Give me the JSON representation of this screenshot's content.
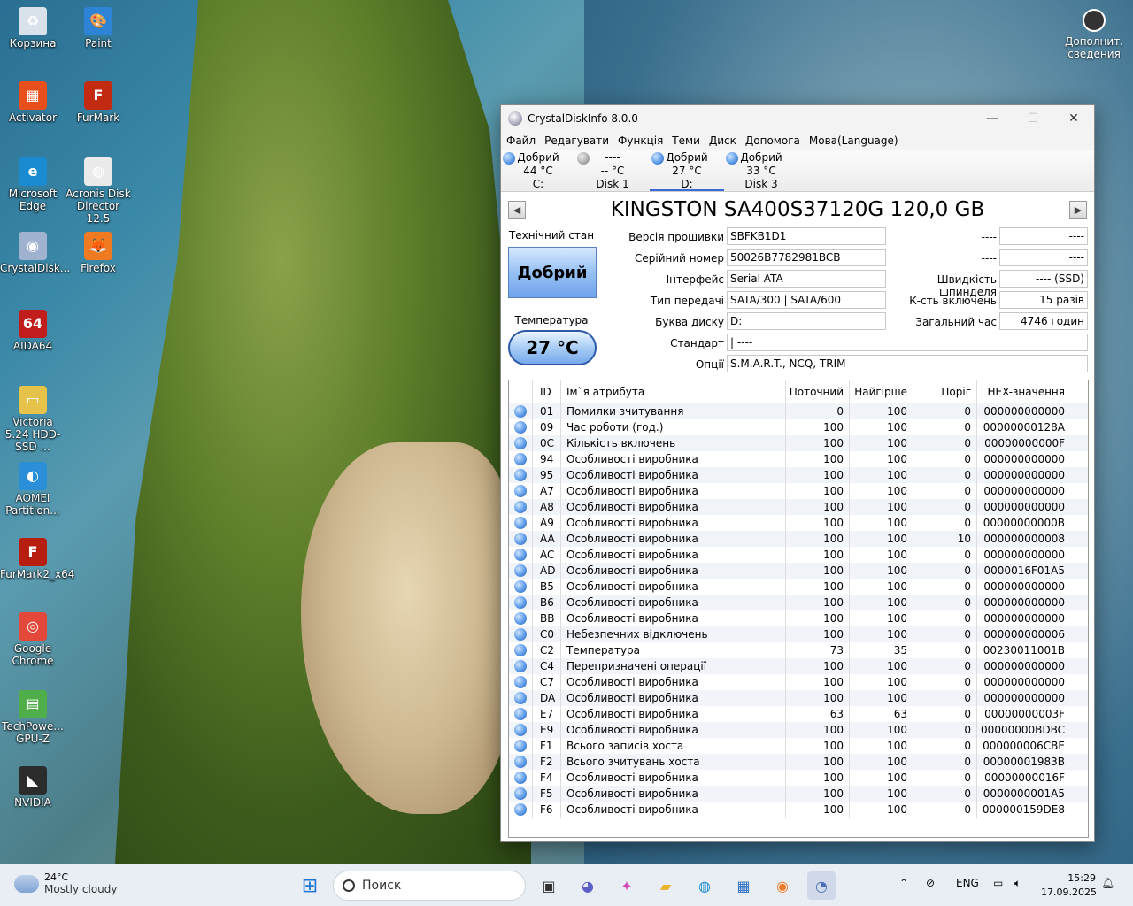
{
  "desktop": {
    "icons": [
      {
        "label": "Корзина",
        "glyph": "♻",
        "color": "#d9e2ea"
      },
      {
        "label": "Paint",
        "glyph": "🎨",
        "color": "#2d83d6"
      },
      {
        "label": "Activator",
        "glyph": "▦",
        "color": "#e84f1a"
      },
      {
        "label": "FurMark",
        "glyph": "F",
        "color": "#c32a12"
      },
      {
        "label": "Microsoft Edge",
        "glyph": "e",
        "color": "#1b8bd1"
      },
      {
        "label": "Acronis Disk Director 12.5",
        "glyph": "◍",
        "color": "#eaeaea"
      },
      {
        "label": "CrystalDisk...",
        "glyph": "◉",
        "color": "#9fb3d1"
      },
      {
        "label": "Firefox",
        "glyph": "🦊",
        "color": "#f07a22"
      },
      {
        "label": "AIDA64",
        "glyph": "64",
        "color": "#c21d1d"
      },
      {
        "label": "Victoria 5.24 HDD-SSD ...",
        "glyph": "▭",
        "color": "#e5c34a"
      },
      {
        "label": "AOMEI Partition...",
        "glyph": "◐",
        "color": "#2a8fd8"
      },
      {
        "label": "FurMark2_x64",
        "glyph": "F",
        "color": "#b81e10"
      },
      {
        "label": "Google Chrome",
        "glyph": "◎",
        "color": "#e4483a"
      },
      {
        "label": "TechPowe... GPU-Z",
        "glyph": "▤",
        "color": "#4fae4a"
      },
      {
        "label": "NVIDIA",
        "glyph": "◣",
        "color": "#2c2c2c"
      }
    ],
    "info_label": "Дополнит. сведения"
  },
  "window": {
    "title": "CrystalDiskInfo 8.0.0",
    "controls": {
      "minimize": "—",
      "maximize": "☐",
      "close": "✕"
    },
    "menu": [
      "Файл",
      "Редагувати",
      "Функція",
      "Теми",
      "Диск",
      "Допомога",
      "Мова(Language)"
    ],
    "disks": [
      {
        "status": "Добрий",
        "temp": "44 °C",
        "name": "C:",
        "dot": "good"
      },
      {
        "status": "----",
        "temp": "-- °C",
        "name": "Disk 1",
        "dot": "none"
      },
      {
        "status": "Добрий",
        "temp": "27 °C",
        "name": "D:",
        "dot": "good"
      },
      {
        "status": "Добрий",
        "temp": "33 °C",
        "name": "Disk 3",
        "dot": "good"
      }
    ],
    "model": "KINGSTON SA400S37120G 120,0 GB",
    "nav": {
      "prev": "◀",
      "next": "▶"
    },
    "health_label": "Технічний стан",
    "health_value": "Добрий",
    "temp_label": "Температура",
    "temp_value": "27 °C",
    "labels": {
      "firmware": "Версія прошивки",
      "serial": "Серійний номер",
      "interface": "Інтерфейс",
      "transfer": "Тип передачі",
      "drive_letter": "Буква диску",
      "standard": "Стандарт",
      "features": "Опції",
      "blank1": "----",
      "blank2": "----",
      "rotation": "Швидкість шпинделя",
      "power_count": "К-сть включень",
      "power_hours": "Загальний час"
    },
    "values": {
      "firmware": "SBFKB1D1",
      "serial": "50026B7782981BCB",
      "interface": "Serial ATA",
      "transfer": "SATA/300 | SATA/600",
      "drive_letter": "D:",
      "standard": "| ----",
      "features": "S.M.A.R.T., NCQ, TRIM",
      "blank1": "----",
      "blank2": "----",
      "rotation": "---- (SSD)",
      "power_count": "15 разів",
      "power_hours": "4746 годин"
    },
    "smart": {
      "headers": {
        "id": "ID",
        "name": "Ім`я атрибута",
        "current": "Поточний",
        "worst": "Найгірше",
        "threshold": "Поріг",
        "raw": "HEX-значення"
      },
      "rows": [
        {
          "id": "01",
          "name": "Помилки зчитування",
          "current": "0",
          "worst": "100",
          "threshold": "0",
          "raw": "000000000000"
        },
        {
          "id": "09",
          "name": "Час роботи (год.)",
          "current": "100",
          "worst": "100",
          "threshold": "0",
          "raw": "00000000128A"
        },
        {
          "id": "0C",
          "name": "Кількість включень",
          "current": "100",
          "worst": "100",
          "threshold": "0",
          "raw": "00000000000F"
        },
        {
          "id": "94",
          "name": "Особливості виробника",
          "current": "100",
          "worst": "100",
          "threshold": "0",
          "raw": "000000000000"
        },
        {
          "id": "95",
          "name": "Особливості виробника",
          "current": "100",
          "worst": "100",
          "threshold": "0",
          "raw": "000000000000"
        },
        {
          "id": "A7",
          "name": "Особливості виробника",
          "current": "100",
          "worst": "100",
          "threshold": "0",
          "raw": "000000000000"
        },
        {
          "id": "A8",
          "name": "Особливості виробника",
          "current": "100",
          "worst": "100",
          "threshold": "0",
          "raw": "000000000000"
        },
        {
          "id": "A9",
          "name": "Особливості виробника",
          "current": "100",
          "worst": "100",
          "threshold": "0",
          "raw": "00000000000B"
        },
        {
          "id": "AA",
          "name": "Особливості виробника",
          "current": "100",
          "worst": "100",
          "threshold": "10",
          "raw": "000000000008"
        },
        {
          "id": "AC",
          "name": "Особливості виробника",
          "current": "100",
          "worst": "100",
          "threshold": "0",
          "raw": "000000000000"
        },
        {
          "id": "AD",
          "name": "Особливості виробника",
          "current": "100",
          "worst": "100",
          "threshold": "0",
          "raw": "0000016F01A5"
        },
        {
          "id": "B5",
          "name": "Особливості виробника",
          "current": "100",
          "worst": "100",
          "threshold": "0",
          "raw": "000000000000"
        },
        {
          "id": "B6",
          "name": "Особливості виробника",
          "current": "100",
          "worst": "100",
          "threshold": "0",
          "raw": "000000000000"
        },
        {
          "id": "BB",
          "name": "Особливості виробника",
          "current": "100",
          "worst": "100",
          "threshold": "0",
          "raw": "000000000000"
        },
        {
          "id": "C0",
          "name": "Небезпечних відключень",
          "current": "100",
          "worst": "100",
          "threshold": "0",
          "raw": "000000000006"
        },
        {
          "id": "C2",
          "name": "Температура",
          "current": "73",
          "worst": "35",
          "threshold": "0",
          "raw": "00230011001B"
        },
        {
          "id": "C4",
          "name": "Перепризначені операції",
          "current": "100",
          "worst": "100",
          "threshold": "0",
          "raw": "000000000000"
        },
        {
          "id": "C7",
          "name": "Особливості виробника",
          "current": "100",
          "worst": "100",
          "threshold": "0",
          "raw": "000000000000"
        },
        {
          "id": "DA",
          "name": "Особливості виробника",
          "current": "100",
          "worst": "100",
          "threshold": "0",
          "raw": "000000000000"
        },
        {
          "id": "E7",
          "name": "Особливості виробника",
          "current": "63",
          "worst": "63",
          "threshold": "0",
          "raw": "00000000003F"
        },
        {
          "id": "E9",
          "name": "Особливості виробника",
          "current": "100",
          "worst": "100",
          "threshold": "0",
          "raw": "00000000BDBC"
        },
        {
          "id": "F1",
          "name": "Всього записів хоста",
          "current": "100",
          "worst": "100",
          "threshold": "0",
          "raw": "000000006CBE"
        },
        {
          "id": "F2",
          "name": "Всього зчитувань хоста",
          "current": "100",
          "worst": "100",
          "threshold": "0",
          "raw": "00000001983B"
        },
        {
          "id": "F4",
          "name": "Особливості виробника",
          "current": "100",
          "worst": "100",
          "threshold": "0",
          "raw": "00000000016F"
        },
        {
          "id": "F5",
          "name": "Особливості виробника",
          "current": "100",
          "worst": "100",
          "threshold": "0",
          "raw": "0000000001A5"
        },
        {
          "id": "F6",
          "name": "Особливості виробника",
          "current": "100",
          "worst": "100",
          "threshold": "0",
          "raw": "000000159DE8"
        }
      ]
    }
  },
  "taskbar": {
    "weather_temp": "24°C",
    "weather_desc": "Mostly cloudy",
    "search_placeholder": "Поиск",
    "language": "ENG",
    "time": "15:29",
    "date": "17.09.2025"
  }
}
